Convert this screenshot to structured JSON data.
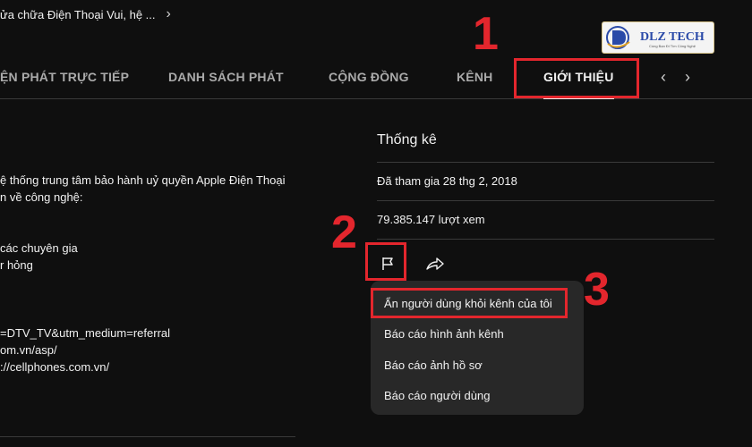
{
  "breadcrumb": {
    "text": "ửa chữa Điện Thoại Vui, hệ ...",
    "chevron_icon": "chevron-right-icon"
  },
  "tabs": [
    {
      "label": "ỆN PHÁT TRỰC TIẾP"
    },
    {
      "label": "DANH SÁCH PHÁT"
    },
    {
      "label": "CỘNG ĐỒNG"
    },
    {
      "label": "KÊNH"
    },
    {
      "label": "GIỚI THIỆU",
      "active": true
    }
  ],
  "description": {
    "lines": [
      "ệ thống trung tâm bảo hành uỷ quyền Apple Điện Thoại",
      "n về công nghệ:",
      "các chuyên gia",
      "r hỏng",
      "=DTV_TV&utm_medium=referral",
      "om.vn/asp/",
      "://cellphones.com.vn/"
    ]
  },
  "stats": {
    "title": "Thống kê",
    "joined": "Đã tham gia 28 thg 2, 2018",
    "views": "79.385.147 lượt xem"
  },
  "actions": {
    "flag_icon": "flag-icon",
    "share_icon": "share-icon"
  },
  "menu": {
    "items": [
      "Ẩn người dùng khỏi kênh của tôi",
      "Báo cáo hình ảnh kênh",
      "Báo cáo ảnh hồ sơ",
      "Báo cáo người dùng"
    ]
  },
  "annotations": {
    "step1": "1",
    "step2": "2",
    "step3": "3",
    "color": "#e3262d"
  },
  "logo": {
    "text": "DLZ TECH",
    "tagline": "Cùng Bạn Đi Tìm Công Nghệ"
  }
}
